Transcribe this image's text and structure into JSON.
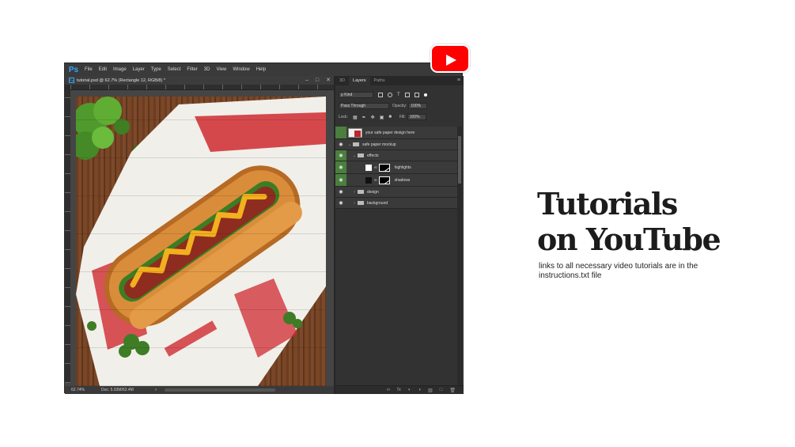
{
  "app": {
    "logo": "Ps",
    "menu": [
      "File",
      "Edit",
      "Image",
      "Layer",
      "Type",
      "Select",
      "Filter",
      "3D",
      "View",
      "Window",
      "Help"
    ]
  },
  "document": {
    "tab_icon": "Ps",
    "tab_title": "tutorial.psd @ 62.7% (Rectangle 12, RGB/8) *",
    "zoom": "62.74%",
    "doc_size": "Doc: 5.93M/62.4M"
  },
  "panel": {
    "tabs": [
      "3D",
      "Layers",
      "Paths"
    ],
    "active_tab": "Layers",
    "kind_label": "ρ Kind",
    "blend_mode": "Pass Through",
    "opacity_label": "Opacity:",
    "opacity_value": "100%",
    "lock_label": "Lock:",
    "fill_label": "Fill:",
    "fill_value": "100%",
    "layers": [
      {
        "name": "your safe paper design here",
        "type": "smart",
        "visible": false
      },
      {
        "name": "safe paper mockup",
        "type": "group",
        "visible": true,
        "expanded": true
      },
      {
        "name": "effects",
        "type": "group",
        "visible": true,
        "expanded": true
      },
      {
        "name": "highlights",
        "type": "mask",
        "visible": true
      },
      {
        "name": "shadows",
        "type": "mask",
        "visible": true
      },
      {
        "name": "design",
        "type": "group",
        "visible": true,
        "expanded": false
      },
      {
        "name": "background",
        "type": "group",
        "visible": true,
        "expanded": false
      }
    ]
  },
  "promo": {
    "title_line1": "Tutorials",
    "title_line2": "on YouTube",
    "description": "links to all necessary video tutorials are in the instructions.txt file"
  },
  "colors": {
    "youtube_red": "#ff0000",
    "ps_blue": "#31a8ff",
    "layer_eye_green": "#4a7f3e"
  }
}
